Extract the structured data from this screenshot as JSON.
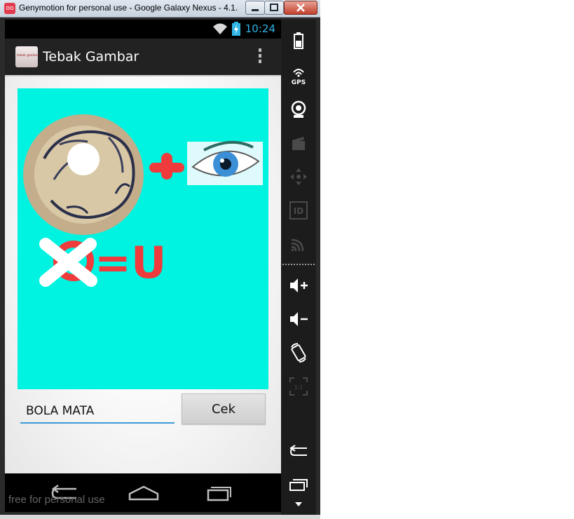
{
  "window": {
    "title": "Genymotion for personal use - Google Galaxy Nexus - 4.1.",
    "app_icon_glyph": "oo",
    "buttons": [
      "minimize-icon",
      "maximize-icon",
      "close-icon"
    ]
  },
  "status_bar": {
    "time": "10:24",
    "icons": [
      "wifi-icon",
      "battery-charging-icon"
    ],
    "accent_color": "#33b5e5"
  },
  "action_bar": {
    "title": "Tebak Gambar",
    "app_icon_text": "tebak gambar",
    "overflow_icon": "overflow-menu-icon"
  },
  "puzzle": {
    "background_color": "#00f3e0",
    "clue_icons": [
      "donut-cake-icon",
      "plus-icon",
      "eye-icon",
      "crossed-o-icon"
    ],
    "rule_text": "=U"
  },
  "answer": {
    "value": "BOLA MATA",
    "button_label": "Cek"
  },
  "nav_bar": {
    "icons": [
      "back-icon",
      "home-icon",
      "recent-apps-icon"
    ]
  },
  "watermark": "free for personal use",
  "side_panel": {
    "icons": [
      "battery-icon",
      "gps-icon",
      "webcam-icon",
      "clapper-icon",
      "dpad-icon",
      "id-icon",
      "cast-icon",
      "volume-up-icon",
      "volume-down-icon",
      "rotate-icon",
      "pixel-scale-icon",
      "back-icon",
      "recent-apps-icon",
      "menu-down-icon"
    ],
    "gps_label": "GPS",
    "id_label": "ID",
    "scale_label": "1:1"
  }
}
